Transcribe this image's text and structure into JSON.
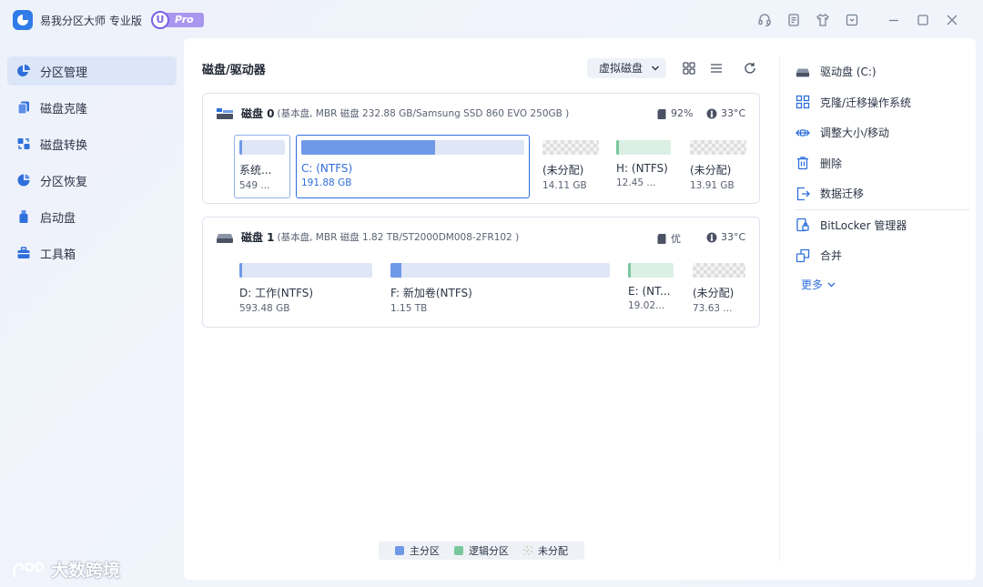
{
  "app": {
    "title": "易我分区大师 专业版",
    "badge_u": "U",
    "badge_pro": "Pro"
  },
  "titlebar_icons": [
    "headset-icon",
    "notes-icon",
    "tshirt-icon",
    "download-box-icon",
    "minimize-icon",
    "maximize-icon",
    "close-icon"
  ],
  "sidebar": {
    "items": [
      {
        "label": "分区管理",
        "icon": "pie-chart-icon",
        "active": true
      },
      {
        "label": "磁盘克隆",
        "icon": "clone-icon",
        "active": false
      },
      {
        "label": "磁盘转换",
        "icon": "convert-icon",
        "active": false
      },
      {
        "label": "分区恢复",
        "icon": "recover-icon",
        "active": false
      },
      {
        "label": "启动盘",
        "icon": "usb-icon",
        "active": false
      },
      {
        "label": "工具箱",
        "icon": "toolbox-icon",
        "active": false
      }
    ]
  },
  "main": {
    "title": "磁盘/驱动器",
    "virtual_disk": "虚拟磁盘"
  },
  "disks": [
    {
      "name": "磁盘 0",
      "info": "(基本盘, MBR 磁盘 232.88 GB/Samsung SSD 860 EVO 250GB )",
      "health": "92%",
      "temp": "33°C",
      "partitions": [
        {
          "name": "系统...",
          "size": "549 ...",
          "type": "primary",
          "used": 0.05
        },
        {
          "name": "C: (NTFS)",
          "size": "191.88 GB",
          "type": "primary",
          "used": 0.6,
          "selected": true
        },
        {
          "name": "(未分配)",
          "size": "14.11 GB",
          "type": "unallocated",
          "used": 0
        },
        {
          "name": "H: (NTFS)",
          "size": "12.45 ...",
          "type": "logical",
          "used": 0.05
        },
        {
          "name": "(未分配)",
          "size": "13.91 GB",
          "type": "unallocated",
          "used": 0
        }
      ]
    },
    {
      "name": "磁盘 1",
      "info": "(基本盘, MBR 磁盘 1.82 TB/ST2000DM008-2FR102 )",
      "health": "优",
      "temp": "33°C",
      "partitions": [
        {
          "name": "D: 工作(NTFS)",
          "size": "593.48 GB",
          "type": "primary",
          "used": 0.02
        },
        {
          "name": "F: 新加卷(NTFS)",
          "size": "1.15 TB",
          "type": "primary",
          "used": 0.05
        },
        {
          "name": "E: (NT...",
          "size": "19.02...",
          "type": "logical",
          "used": 0.05
        },
        {
          "name": "(未分配)",
          "size": "73.63 ...",
          "type": "unallocated",
          "used": 0
        }
      ]
    }
  ],
  "legend": {
    "primary": "主分区",
    "logical": "逻辑分区",
    "unallocated": "未分配"
  },
  "colors": {
    "accent": "#2f6fdc",
    "primary_partition": "#6f99e8",
    "logical_partition": "#7ac79d",
    "active_nav_bg": "#dbe6f8"
  },
  "actions": {
    "drive": "驱动盘 (C:)",
    "clone_migrate": "克隆/迁移操作系统",
    "resize": "调整大小/移动",
    "delete": "删除",
    "data_migrate": "数据迁移",
    "bitlocker": "BitLocker 管理器",
    "merge": "合并",
    "more": "更多"
  },
  "watermark": "大数跨境"
}
